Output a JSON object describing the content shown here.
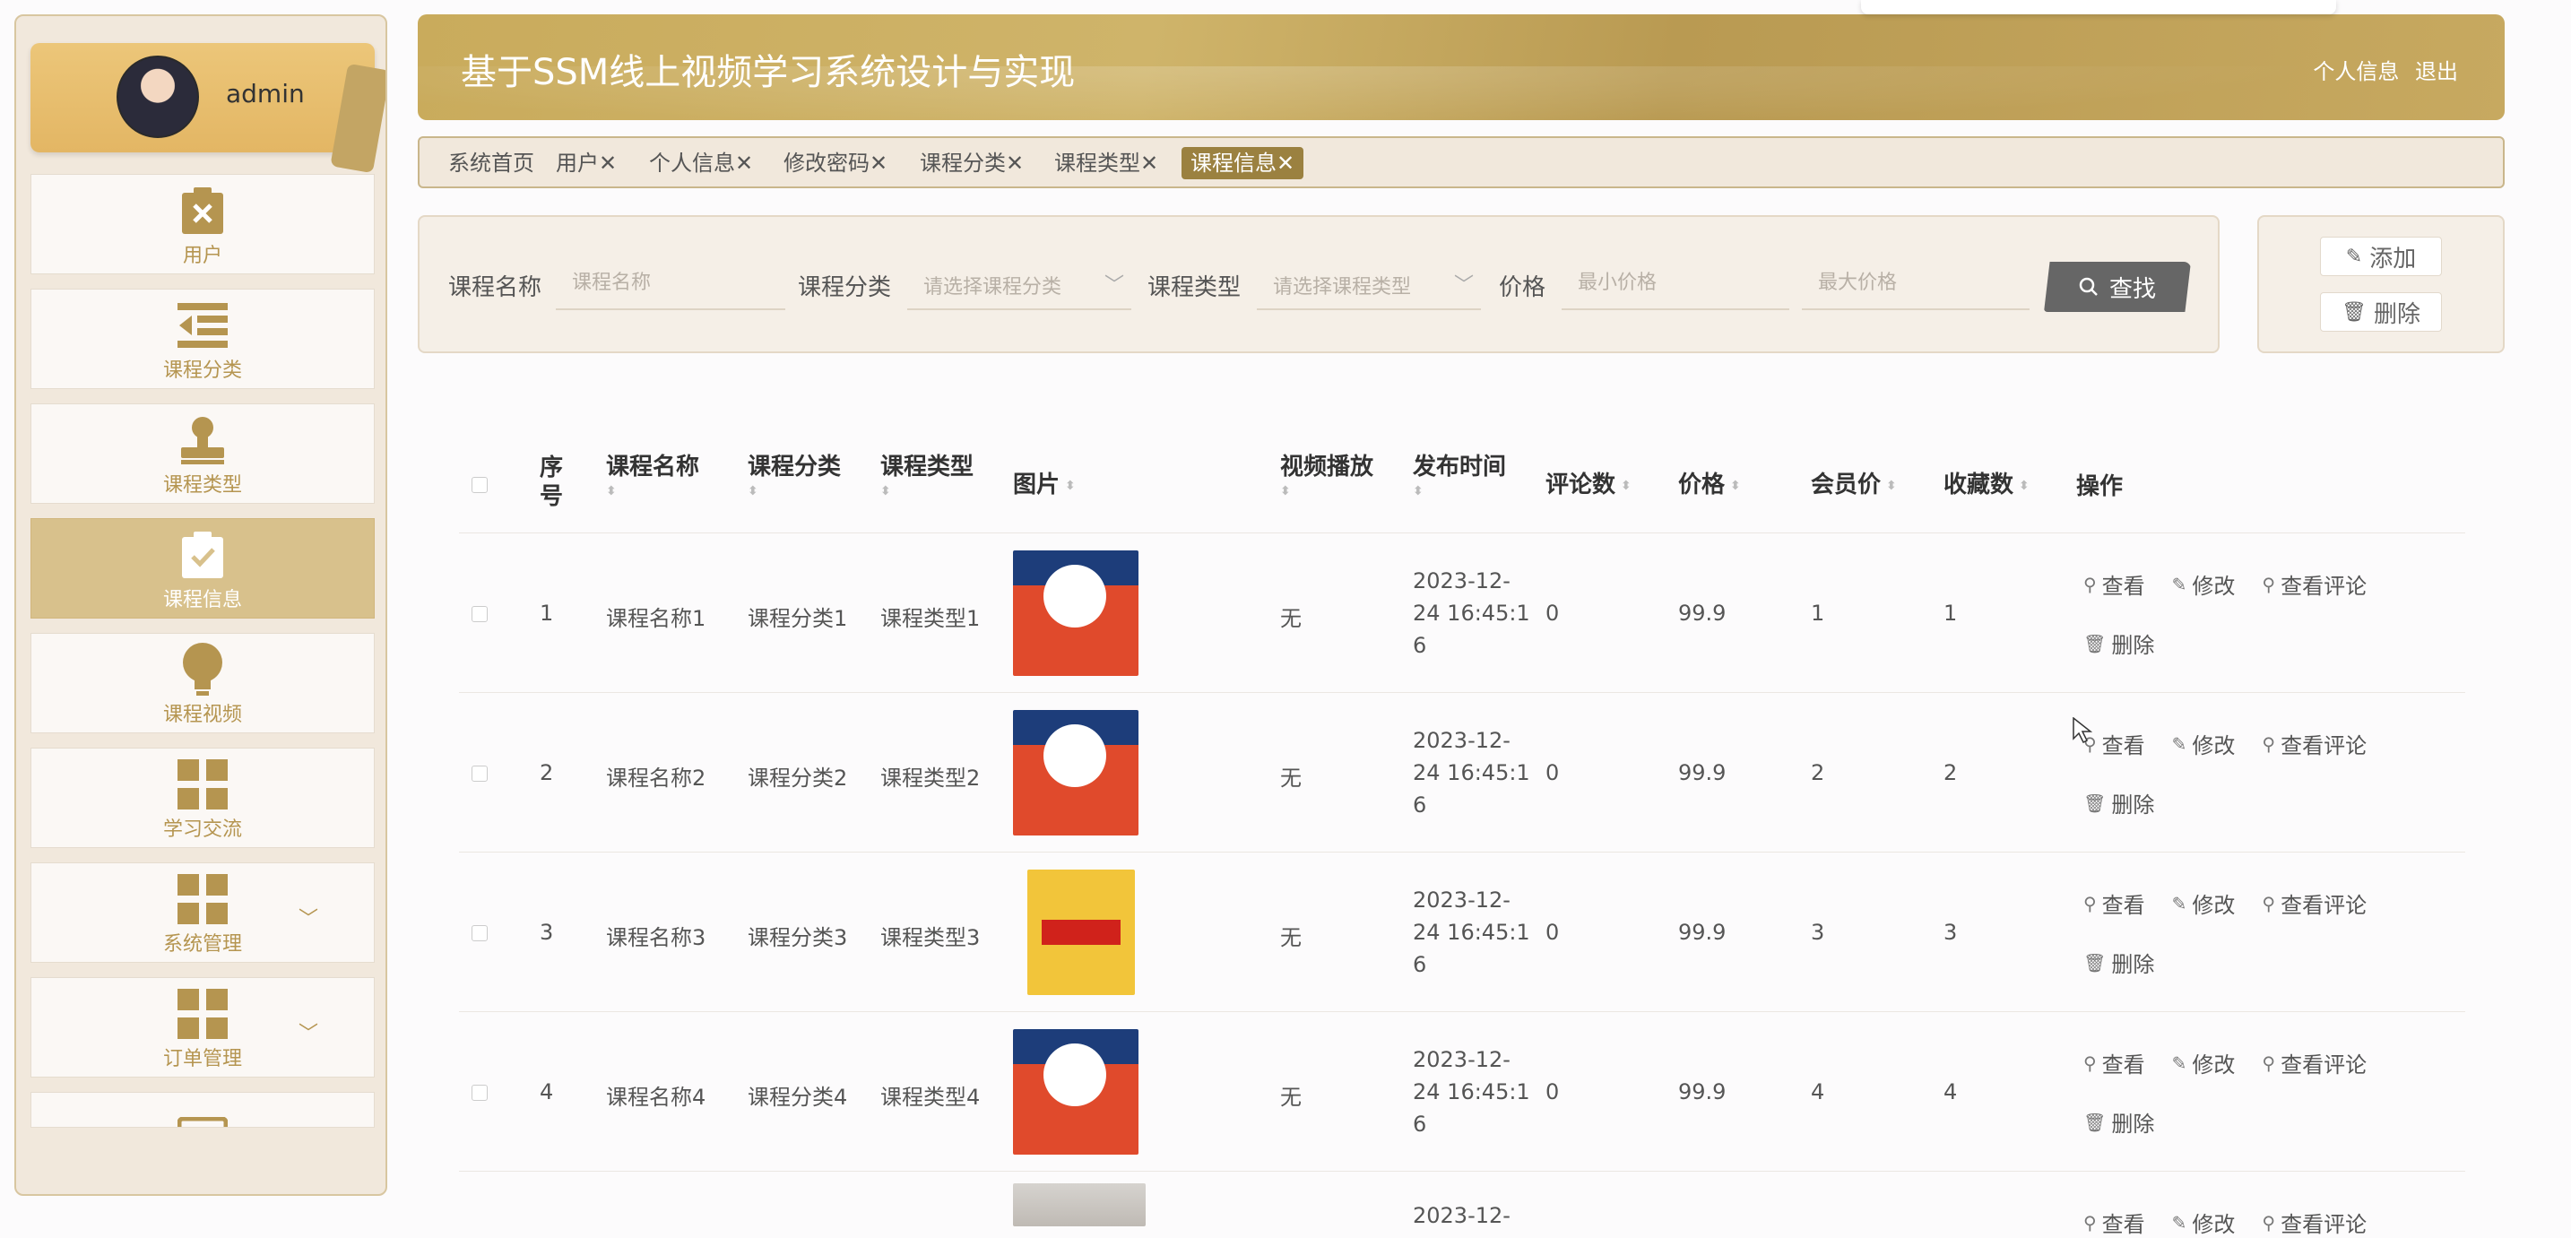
{
  "app": {
    "title": "基于SSM线上视频学习系统设计与实现",
    "header_links": [
      "个人信息",
      "退出"
    ]
  },
  "user": {
    "name": "admin"
  },
  "sidebar": {
    "items": [
      {
        "label": "用户",
        "icon": "clipboard-x-icon"
      },
      {
        "label": "课程分类",
        "icon": "list-indent-icon"
      },
      {
        "label": "课程类型",
        "icon": "stamp-icon"
      },
      {
        "label": "课程信息",
        "icon": "clipboard-check-icon",
        "active": true
      },
      {
        "label": "课程视频",
        "icon": "lightbulb-icon"
      },
      {
        "label": "学习交流",
        "icon": "grid-icon"
      },
      {
        "label": "系统管理",
        "icon": "grid-icon",
        "expandable": true
      },
      {
        "label": "订单管理",
        "icon": "grid-icon",
        "expandable": true
      }
    ]
  },
  "tabs": [
    {
      "label": "系统首页"
    },
    {
      "label": "用户✕"
    },
    {
      "label": "个人信息✕"
    },
    {
      "label": "修改密码✕"
    },
    {
      "label": "课程分类✕"
    },
    {
      "label": "课程类型✕"
    },
    {
      "label": "课程信息✕",
      "active": true
    }
  ],
  "search": {
    "name_label": "课程名称",
    "name_placeholder": "课程名称",
    "category_label": "课程分类",
    "category_placeholder": "请选择课程分类",
    "type_label": "课程类型",
    "type_placeholder": "请选择课程类型",
    "price_label": "价格",
    "min_price_placeholder": "最小价格",
    "max_price_placeholder": "最大价格",
    "search_button": "查找"
  },
  "actions": {
    "add": "添加",
    "delete": "删除"
  },
  "table": {
    "headers": {
      "index": "序号",
      "name": "课程名称",
      "category": "课程分类",
      "type": "课程类型",
      "image": "图片",
      "video": "视频播放",
      "time": "发布时间",
      "comments": "评论数",
      "price": "价格",
      "member_price": "会员价",
      "favorites": "收藏数",
      "ops": "操作"
    },
    "row_ops": {
      "view": "查看",
      "edit": "修改",
      "view_comments": "查看评论",
      "delete": "删除"
    },
    "rows": [
      {
        "index": "1",
        "name": "课程名称1",
        "category": "课程分类1",
        "type": "课程类型1",
        "video": "无",
        "time_1": "2023-12-",
        "time_2": "24 16:45:1",
        "time_3": "6",
        "comments": "0",
        "price": "99.9",
        "member_price": "1",
        "favorites": "1"
      },
      {
        "index": "2",
        "name": "课程名称2",
        "category": "课程分类2",
        "type": "课程类型2",
        "video": "无",
        "time_1": "2023-12-",
        "time_2": "24 16:45:1",
        "time_3": "6",
        "comments": "0",
        "price": "99.9",
        "member_price": "2",
        "favorites": "2"
      },
      {
        "index": "3",
        "name": "课程名称3",
        "category": "课程分类3",
        "type": "课程类型3",
        "video": "无",
        "time_1": "2023-12-",
        "time_2": "24 16:45:1",
        "time_3": "6",
        "comments": "0",
        "price": "99.9",
        "member_price": "3",
        "favorites": "3"
      },
      {
        "index": "4",
        "name": "课程名称4",
        "category": "课程分类4",
        "type": "课程类型4",
        "video": "无",
        "time_1": "2023-12-",
        "time_2": "24 16:45:1",
        "time_3": "6",
        "comments": "0",
        "price": "99.9",
        "member_price": "4",
        "favorites": "4"
      },
      {
        "time_1": "2023-12-"
      }
    ]
  }
}
